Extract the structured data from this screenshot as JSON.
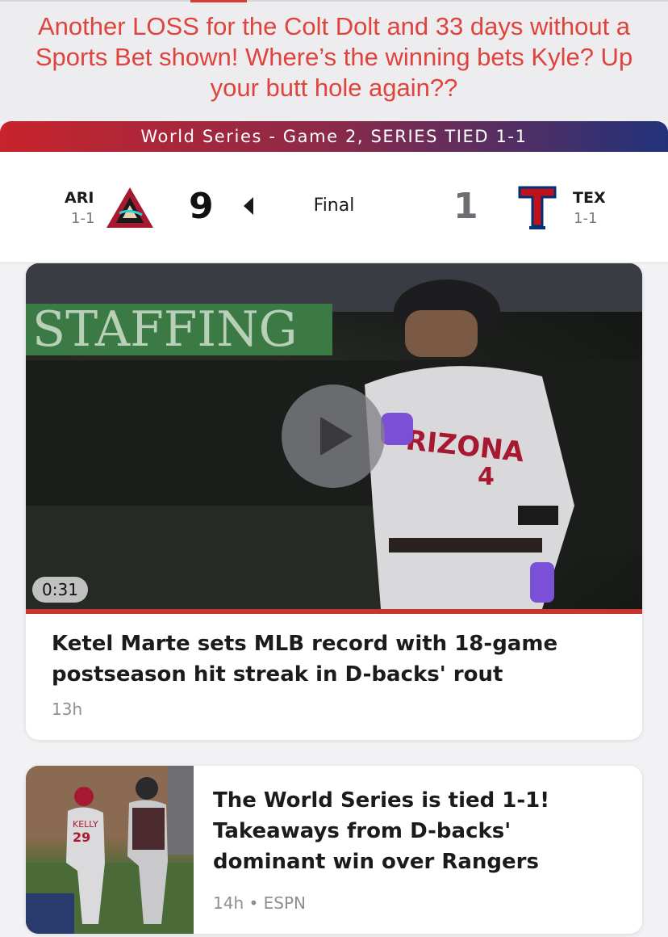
{
  "overlay": {
    "caption": "Another LOSS for the Colt Dolt and 33 days without a Sports Bet shown! Where’s the winning bets Kyle? Up your butt hole again??"
  },
  "banner": {
    "text": "World Series - Game 2, SERIES TIED 1-1"
  },
  "game": {
    "away": {
      "abbr": "ARI",
      "record": "1-1",
      "score": "9",
      "logo_icon": "d-backs-a-logo-icon"
    },
    "home": {
      "abbr": "TEX",
      "record": "1-1",
      "score": "1",
      "logo_icon": "rangers-t-logo-icon"
    },
    "status": "Final",
    "winner": "away"
  },
  "colors": {
    "caption": "#e0433c",
    "banner_left": "#c8242c",
    "banner_right": "#22327a",
    "accent_red": "#c8342e",
    "muted": "#8e8e93"
  },
  "video_card": {
    "duration": "0:31",
    "title": "Ketel Marte sets MLB record with 18-game postseason hit streak in D-backs' rout",
    "time": "13h",
    "thumb_text": {
      "sign": "STAFFING",
      "jersey": "RIZONA",
      "number": "4"
    }
  },
  "article_card": {
    "title": "The World Series is tied 1-1! Takeaways from D-backs' dominant win over Rangers",
    "meta": "14h • ESPN",
    "thumb_text": {
      "jersey_name": "KELLY",
      "jersey_number": "29"
    }
  }
}
